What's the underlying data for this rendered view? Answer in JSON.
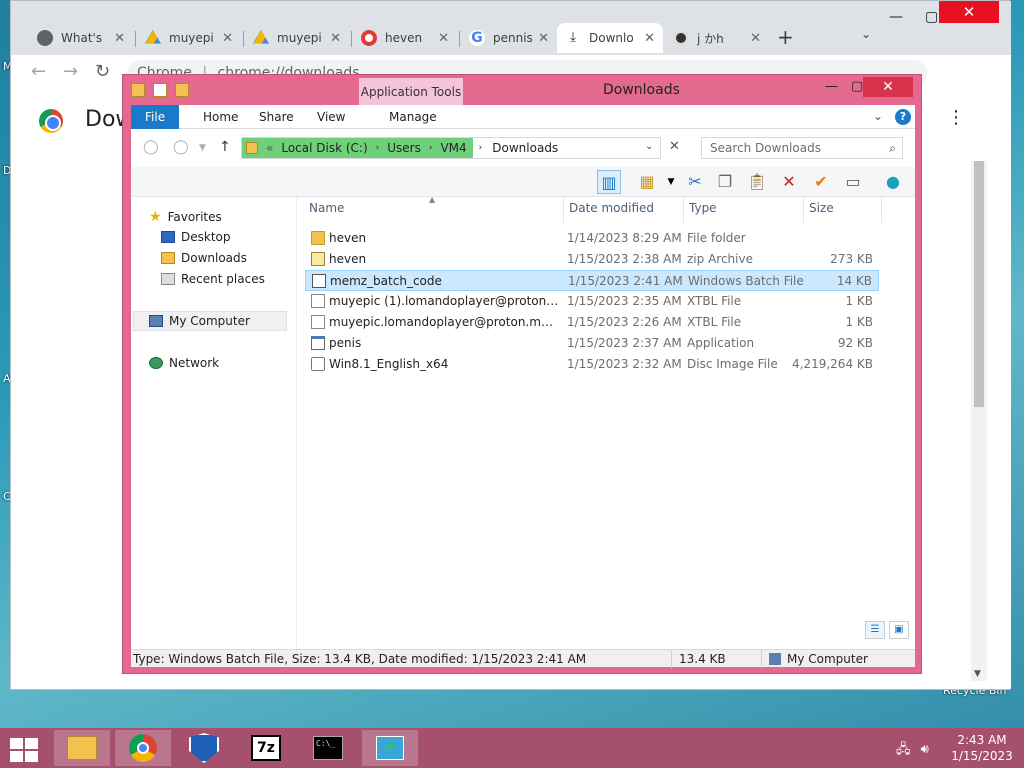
{
  "desktop": {
    "edge_letters": [
      "M",
      "D",
      "A",
      "C"
    ],
    "recycle_bin_label": "Recycle Bin"
  },
  "chrome": {
    "tabs": [
      {
        "title": "What's",
        "icon": "chrome-icon",
        "color": "#5f6368"
      },
      {
        "title": "muyepi",
        "icon": "google-drive-icon",
        "color": "#0f9d58"
      },
      {
        "title": "muyepi",
        "icon": "google-drive-icon",
        "color": "#0f9d58"
      },
      {
        "title": "heven",
        "icon": "site-icon",
        "color": "#e53935"
      },
      {
        "title": "pennis",
        "icon": "google-icon",
        "color": "#4285f4"
      },
      {
        "title": "Downlo",
        "icon": "download-icon",
        "color": "#202124",
        "active": true
      },
      {
        "title": "j かh",
        "icon": "anime-avatar-icon",
        "color": "#555555"
      }
    ],
    "omnibox_site": "Chrome",
    "omnibox_url": "chrome://downloads",
    "page_heading": "Downloads"
  },
  "explorer": {
    "title": "Downloads",
    "contextual_tab": "Application Tools",
    "ribbon_tabs": [
      "File",
      "Home",
      "Share",
      "View",
      "Manage"
    ],
    "breadcrumb": {
      "prefix": "«",
      "parts": [
        "Local Disk (C:)",
        "Users",
        "VM4",
        "Downloads"
      ]
    },
    "search_placeholder": "Search Downloads",
    "nav": {
      "favorites": "Favorites",
      "desktop": "Desktop",
      "downloads": "Downloads",
      "recent": "Recent places",
      "computer": "My Computer",
      "network": "Network"
    },
    "columns": {
      "name": "Name",
      "date": "Date modified",
      "type": "Type",
      "size": "Size"
    },
    "files": [
      {
        "name": "heven",
        "date": "1/14/2023 8:29 AM",
        "type": "File folder",
        "size": "",
        "icon": "folder"
      },
      {
        "name": "heven",
        "date": "1/15/2023 2:38 AM",
        "type": "zip Archive",
        "size": "273 KB",
        "icon": "zip"
      },
      {
        "name": "memz_batch_code",
        "date": "1/15/2023 2:41 AM",
        "type": "Windows Batch File",
        "size": "14 KB",
        "icon": "doc",
        "selected": true
      },
      {
        "name": "muyepic (1).lomandoplayer@proton.me....",
        "date": "1/15/2023 2:35 AM",
        "type": "XTBL File",
        "size": "1 KB",
        "icon": "doc"
      },
      {
        "name": "muyepic.lomandoplayer@proton.me.xtbl",
        "date": "1/15/2023 2:26 AM",
        "type": "XTBL File",
        "size": "1 KB",
        "icon": "doc"
      },
      {
        "name": "penis",
        "date": "1/15/2023 2:37 AM",
        "type": "Application",
        "size": "92 KB",
        "icon": "app"
      },
      {
        "name": "Win8.1_English_x64",
        "date": "1/15/2023 2:32 AM",
        "type": "Disc Image File",
        "size": "4,219,264 KB",
        "icon": "disc"
      }
    ],
    "status": {
      "details": "Type: Windows Batch File, Size: 13.4 KB, Date modified: 1/15/2023 2:41 AM",
      "size": "13.4 KB",
      "location": "My Computer"
    },
    "frame_color": "#e3698f"
  },
  "taskbar": {
    "color": "#a5516d",
    "apps": [
      {
        "name": "file-explorer-icon",
        "running": true
      },
      {
        "name": "chrome-icon",
        "running": true
      },
      {
        "name": "defender-shield-icon",
        "running": false
      },
      {
        "name": "7zip-icon",
        "running": false,
        "label": "7z"
      },
      {
        "name": "command-prompt-icon",
        "running": false,
        "label": "C:\\_"
      },
      {
        "name": "installer-icon",
        "running": true
      }
    ],
    "time": "2:43 AM",
    "date": "1/15/2023"
  }
}
